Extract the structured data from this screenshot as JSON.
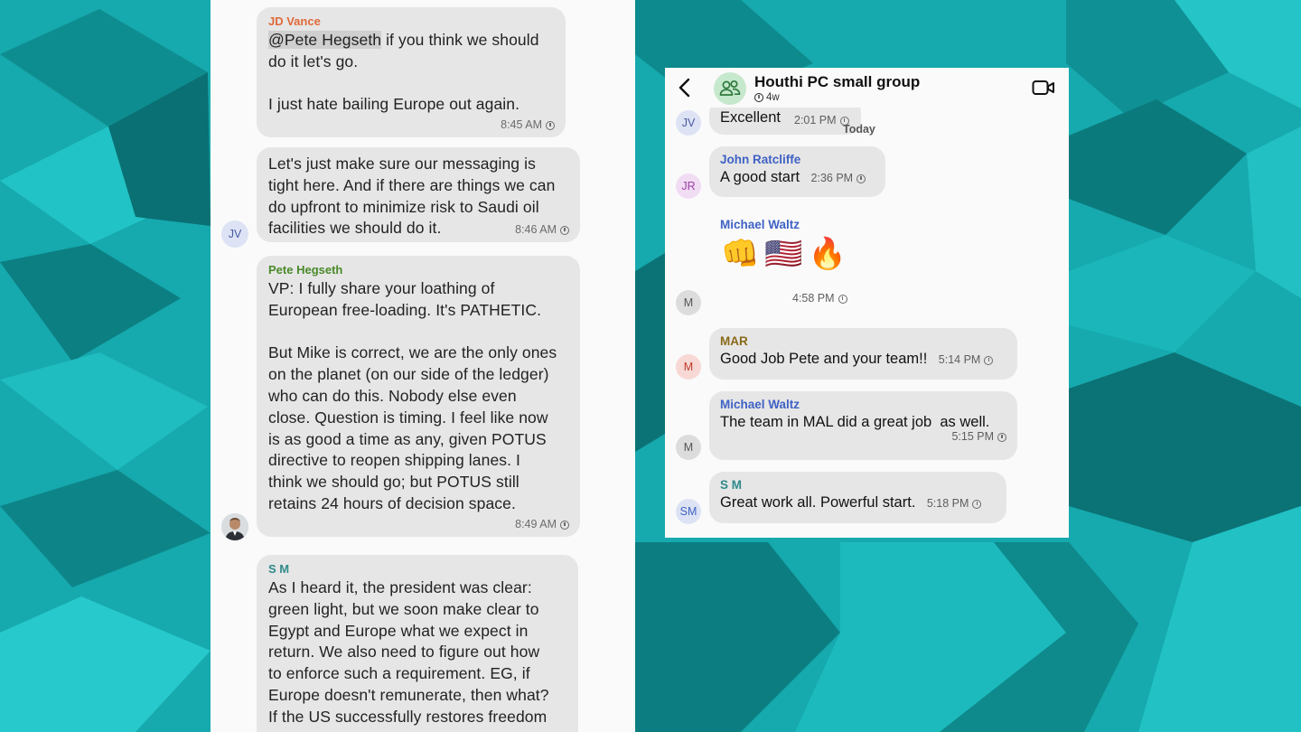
{
  "left_chat": {
    "messages": [
      {
        "sender": "JD Vance",
        "sender_color": "#e06a3a",
        "mention": "@Pete Hegseth",
        "text": " if you think we should\ndo it let's go.\n\nI just hate bailing Europe out again.",
        "time": "8:45 AM"
      },
      {
        "sender": "",
        "text": "Let's just make sure our messaging is\ntight here. And if there are things we can\ndo upfront to minimize risk to Saudi oil\nfacilities we should do it.",
        "time": "8:46 AM",
        "avatar": "JV"
      },
      {
        "sender": "Pete Hegseth",
        "sender_color": "#4a8a2a",
        "text": "VP: I fully share your loathing of\nEuropean free-loading. It's PATHETIC.\n\nBut Mike is correct, we are the only ones\non the planet (on our side of the ledger)\nwho can do this. Nobody else even\nclose. Question is timing. I feel like now\nis as good a time as any, given POTUS\ndirective to reopen shipping lanes. I\nthink we should go; but POTUS still\nretains 24 hours of decision space.",
        "time": "8:49 AM"
      },
      {
        "sender": "S M",
        "sender_color": "#2f8a8a",
        "text": "As I heard it, the president was clear:\ngreen light, but we soon make clear to\nEgypt and Europe what we expect in\nreturn. We also need to figure out how\nto enforce such a requirement. EG, if\nEurope doesn't remunerate, then what?\nIf the US successfully restores freedom"
      }
    ]
  },
  "right_chat": {
    "group_name": "Houthi PC small group",
    "disappearing_timer": "4w",
    "today_label": "Today",
    "messages": [
      {
        "avatar": "JV",
        "avatar_bg": "#dde3f5",
        "avatar_color": "#4a5aa0",
        "text": "Excellent",
        "time": "2:01 PM"
      },
      {
        "sender": "John Ratcliffe",
        "sender_color": "#3f62c4",
        "avatar": "JR",
        "avatar_bg": "#f1ddf3",
        "avatar_color": "#9c3fa8",
        "text": "A good start",
        "time": "2:36 PM"
      },
      {
        "sender": "Michael Waltz",
        "sender_color": "#3f62c4",
        "avatar": "M",
        "avatar_bg": "#dcdcdc",
        "avatar_color": "#555555",
        "emojis": "👊🇺🇸🔥",
        "time": "4:58 PM"
      },
      {
        "sender": "MAR",
        "sender_color": "#8a6a1a",
        "avatar": "M",
        "avatar_bg": "#f8d8d4",
        "avatar_color": "#c0392b",
        "text": "Good Job Pete and your team!!",
        "time": "5:14 PM"
      },
      {
        "sender": "Michael Waltz",
        "sender_color": "#3f62c4",
        "avatar": "M",
        "avatar_bg": "#dcdcdc",
        "avatar_color": "#555555",
        "text": "The team in MAL did a great job  as well.",
        "time": "5:15 PM"
      },
      {
        "sender": "S M",
        "sender_color": "#2f8a8a",
        "avatar": "SM",
        "avatar_bg": "#dde3f5",
        "avatar_color": "#3f62c4",
        "text": "Great work all. Powerful start.",
        "time": "5:18 PM"
      }
    ]
  }
}
